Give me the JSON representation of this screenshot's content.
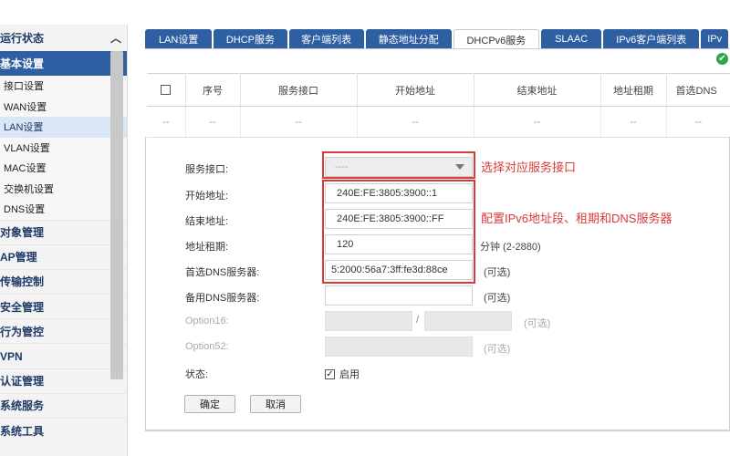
{
  "sidebar": {
    "top_label": "运行状态",
    "group_label": "基本设置",
    "sub_items": [
      {
        "label": "接口设置"
      },
      {
        "label": "WAN设置"
      },
      {
        "label": "LAN设置"
      },
      {
        "label": "VLAN设置"
      },
      {
        "label": "MAC设置"
      },
      {
        "label": "交换机设置"
      },
      {
        "label": "DNS设置"
      }
    ],
    "main_items": [
      {
        "label": "对象管理"
      },
      {
        "label": "AP管理"
      },
      {
        "label": "传输控制"
      },
      {
        "label": "安全管理"
      },
      {
        "label": "行为管控"
      },
      {
        "label": "VPN"
      },
      {
        "label": "认证管理"
      },
      {
        "label": "系统服务"
      },
      {
        "label": "系统工具"
      }
    ]
  },
  "tabs": [
    {
      "label": "LAN设置"
    },
    {
      "label": "DHCP服务"
    },
    {
      "label": "客户端列表"
    },
    {
      "label": "静态地址分配"
    },
    {
      "label": "DHCPv6服务"
    },
    {
      "label": "SLAAC"
    },
    {
      "label": "IPv6客户端列表"
    },
    {
      "label": "IPv"
    }
  ],
  "table": {
    "headers": [
      "序号",
      "服务接口",
      "开始地址",
      "结束地址",
      "地址租期",
      "首选DNS"
    ],
    "empty_row": [
      "--",
      "--",
      "--",
      "--",
      "--",
      "--",
      "--",
      "--"
    ]
  },
  "form": {
    "service_interface_label": "服务接口:",
    "service_interface_value": "----",
    "start_label": "开始地址:",
    "start_value": "240E:FE:3805:3900::1",
    "end_label": "结束地址:",
    "end_value": "240E:FE:3805:3900::FF",
    "lease_label": "地址租期:",
    "lease_value": "120",
    "lease_note": "分钟 (2-2880)",
    "dns1_label": "首选DNS服务器:",
    "dns1_value": "5:2000:56a7:3ff:fe3d:88ce",
    "dns1_note": "(可选)",
    "dns2_label": "备用DNS服务器:",
    "dns2_value": "",
    "dns2_note": "(可选)",
    "opt16_label": "Option16:",
    "opt16_sep": "/",
    "opt16_note": "(可选)",
    "opt52_label": "Option52:",
    "opt52_note": "(可选)",
    "status_label": "状态:",
    "status_check_mark": "✓",
    "status_value": "启用",
    "confirm_button": "确定",
    "cancel_button": "取消"
  },
  "annotations": {
    "select_interface": "选择对应服务接口",
    "configure_ipv6": "配置IPv6地址段、租期和DNS服务器"
  },
  "icons": {
    "collapse": "chevron-up-icon",
    "status_ok": "check-circle-icon"
  },
  "colors": {
    "brand_blue": "#2f5fa3",
    "annotation_red": "#d93a3a",
    "ok_green": "#2ea44f"
  }
}
